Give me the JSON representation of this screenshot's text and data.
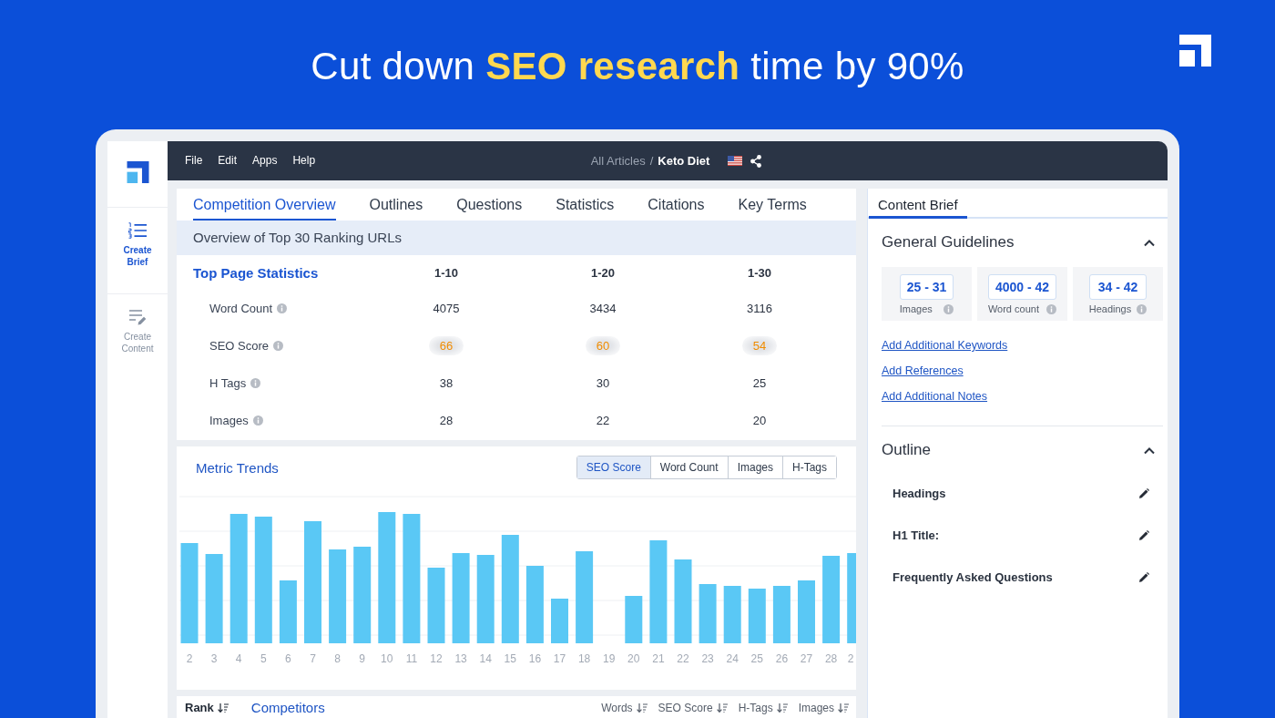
{
  "headline": {
    "text": "Cut down **SEO research** time by 90%"
  },
  "sidebar": {
    "items": [
      {
        "kind": "brief",
        "label": "Create Brief",
        "selected": true
      },
      {
        "kind": "content",
        "label": "Create Content",
        "selected": false
      }
    ]
  },
  "topbar": {
    "menu": [
      "File",
      "Edit",
      "Apps",
      "Help"
    ],
    "breadcrumb": {
      "parent": "All Articles",
      "separator": "/",
      "current": "Keto Diet"
    }
  },
  "tabs": [
    {
      "label": "Competition Overview",
      "selected": true
    },
    {
      "label": "Outlines",
      "selected": false
    },
    {
      "label": "Questions",
      "selected": false
    },
    {
      "label": "Statistics",
      "selected": false
    },
    {
      "label": "Citations",
      "selected": false
    },
    {
      "label": "Key Terms",
      "selected": false
    }
  ],
  "overview": {
    "title": "Overview of Top 30 Ranking URLs"
  },
  "top_page_statistics": {
    "title": "Top Page Statistics",
    "columns": [
      "1-10",
      "1-20",
      "1-30"
    ],
    "rows": [
      {
        "label": "Word Count",
        "kind": "count",
        "values": [
          "4075",
          "3434",
          "3116"
        ]
      },
      {
        "label": "SEO Score",
        "kind": "score",
        "values": [
          "66",
          "60",
          "54"
        ]
      },
      {
        "label": "H Tags",
        "kind": "count",
        "values": [
          "38",
          "30",
          "25"
        ]
      },
      {
        "label": "Images",
        "kind": "count",
        "values": [
          "28",
          "22",
          "20"
        ]
      }
    ]
  },
  "metric_trends": {
    "title": "Metric Trends",
    "options": [
      {
        "label": "SEO Score",
        "selected": true
      },
      {
        "label": "Word Count",
        "selected": false
      },
      {
        "label": "Images",
        "selected": false
      },
      {
        "label": "H-Tags",
        "selected": false
      }
    ],
    "x_labels": [
      "2",
      "3",
      "4",
      "5",
      "6",
      "7",
      "8",
      "9",
      "10",
      "11",
      "12",
      "13",
      "14",
      "15",
      "16",
      "17",
      "18",
      "19",
      "20",
      "21",
      "22",
      "23",
      "24",
      "25",
      "26",
      "27",
      "28",
      "2"
    ]
  },
  "competitors_table": {
    "columns": [
      {
        "label": "Rank",
        "kind": "rank",
        "sortable": true
      },
      {
        "label": "Competitors",
        "kind": "name",
        "sortable": false
      },
      {
        "label": "Words",
        "kind": "metric",
        "sortable": true
      },
      {
        "label": "SEO Score",
        "kind": "metric",
        "sortable": true
      },
      {
        "label": "H-Tags",
        "kind": "metric",
        "sortable": true
      },
      {
        "label": "Images",
        "kind": "metric",
        "sortable": true
      }
    ]
  },
  "content_brief": {
    "tabs": [
      {
        "label": "Content Brief",
        "selected": true
      }
    ],
    "sections": [
      {
        "kind": "guidelines",
        "title": "General Guidelines",
        "expanded": true,
        "metrics": [
          {
            "value": "25 - 31",
            "label": "Images"
          },
          {
            "value": "4000 - 42",
            "label": "Word count"
          },
          {
            "value": "34 - 42",
            "label": "Headings"
          }
        ],
        "links": [
          "Add Additional Keywords",
          "Add References",
          "Add Additional Notes"
        ]
      },
      {
        "kind": "outline",
        "title": "Outline",
        "expanded": true,
        "items": [
          "Headings",
          "H1 Title:",
          "Frequently Asked Questions"
        ]
      }
    ]
  }
}
